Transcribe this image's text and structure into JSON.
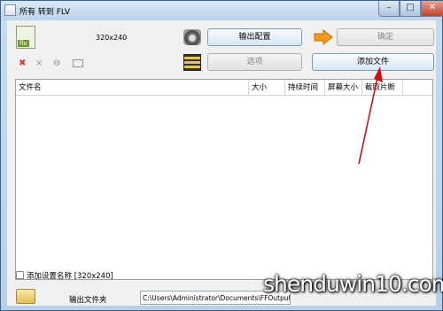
{
  "window": {
    "title": "所有 转到 FLV",
    "controls": {
      "minimize": "–",
      "maximize": "□",
      "close": "✕"
    }
  },
  "toolbar": {
    "format_badge": "flv",
    "resolution": "320x240",
    "output_config_label": "输出配置",
    "ok_label": "确定",
    "options_label": "选项",
    "add_file_label": "添加文件"
  },
  "icons": {
    "format": "flv-file-icon",
    "settings": "settings-icon",
    "arrow": "arrow-right-icon",
    "film": "film-icon",
    "add": "add-file-icon",
    "delete": "delete-icon",
    "clear": "clear-icon",
    "refresh": "refresh-icon",
    "panel": "panel-icon",
    "folder": "folder-icon"
  },
  "table": {
    "columns": [
      "文件名",
      "大小",
      "持续时间",
      "屏幕大小",
      "截取片断"
    ],
    "rows": []
  },
  "footer": {
    "add_setting_name_label": "添加设置名称 [320x240]",
    "output_folder_label": "输出文件夹",
    "output_folder_path": "C:\\Users\\Administrator\\Documents\\FFOutput"
  },
  "annotation": {
    "color": "#cc1111"
  },
  "watermark": {
    "text": "shenduwin10.com"
  }
}
